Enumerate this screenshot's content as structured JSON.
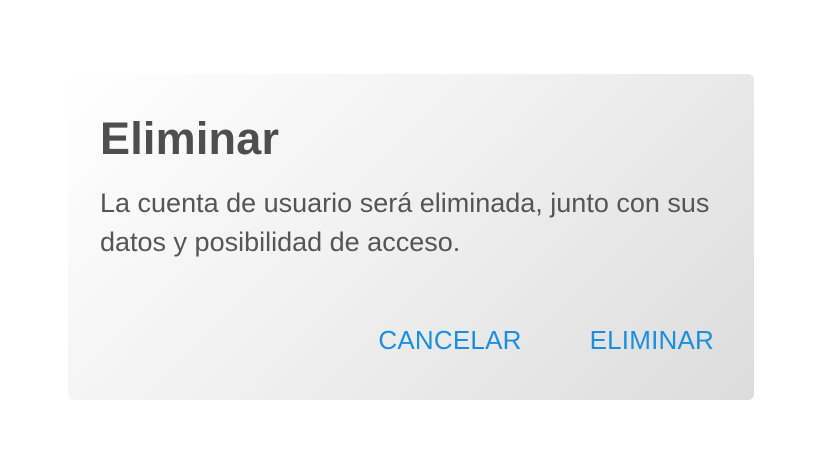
{
  "dialog": {
    "title": "Eliminar",
    "message": "La cuenta de usuario será eliminada, junto con sus datos y posibilidad de acceso.",
    "cancel_label": "CANCELAR",
    "confirm_label": "ELIMINAR",
    "accent_color": "#1a8fe0"
  }
}
